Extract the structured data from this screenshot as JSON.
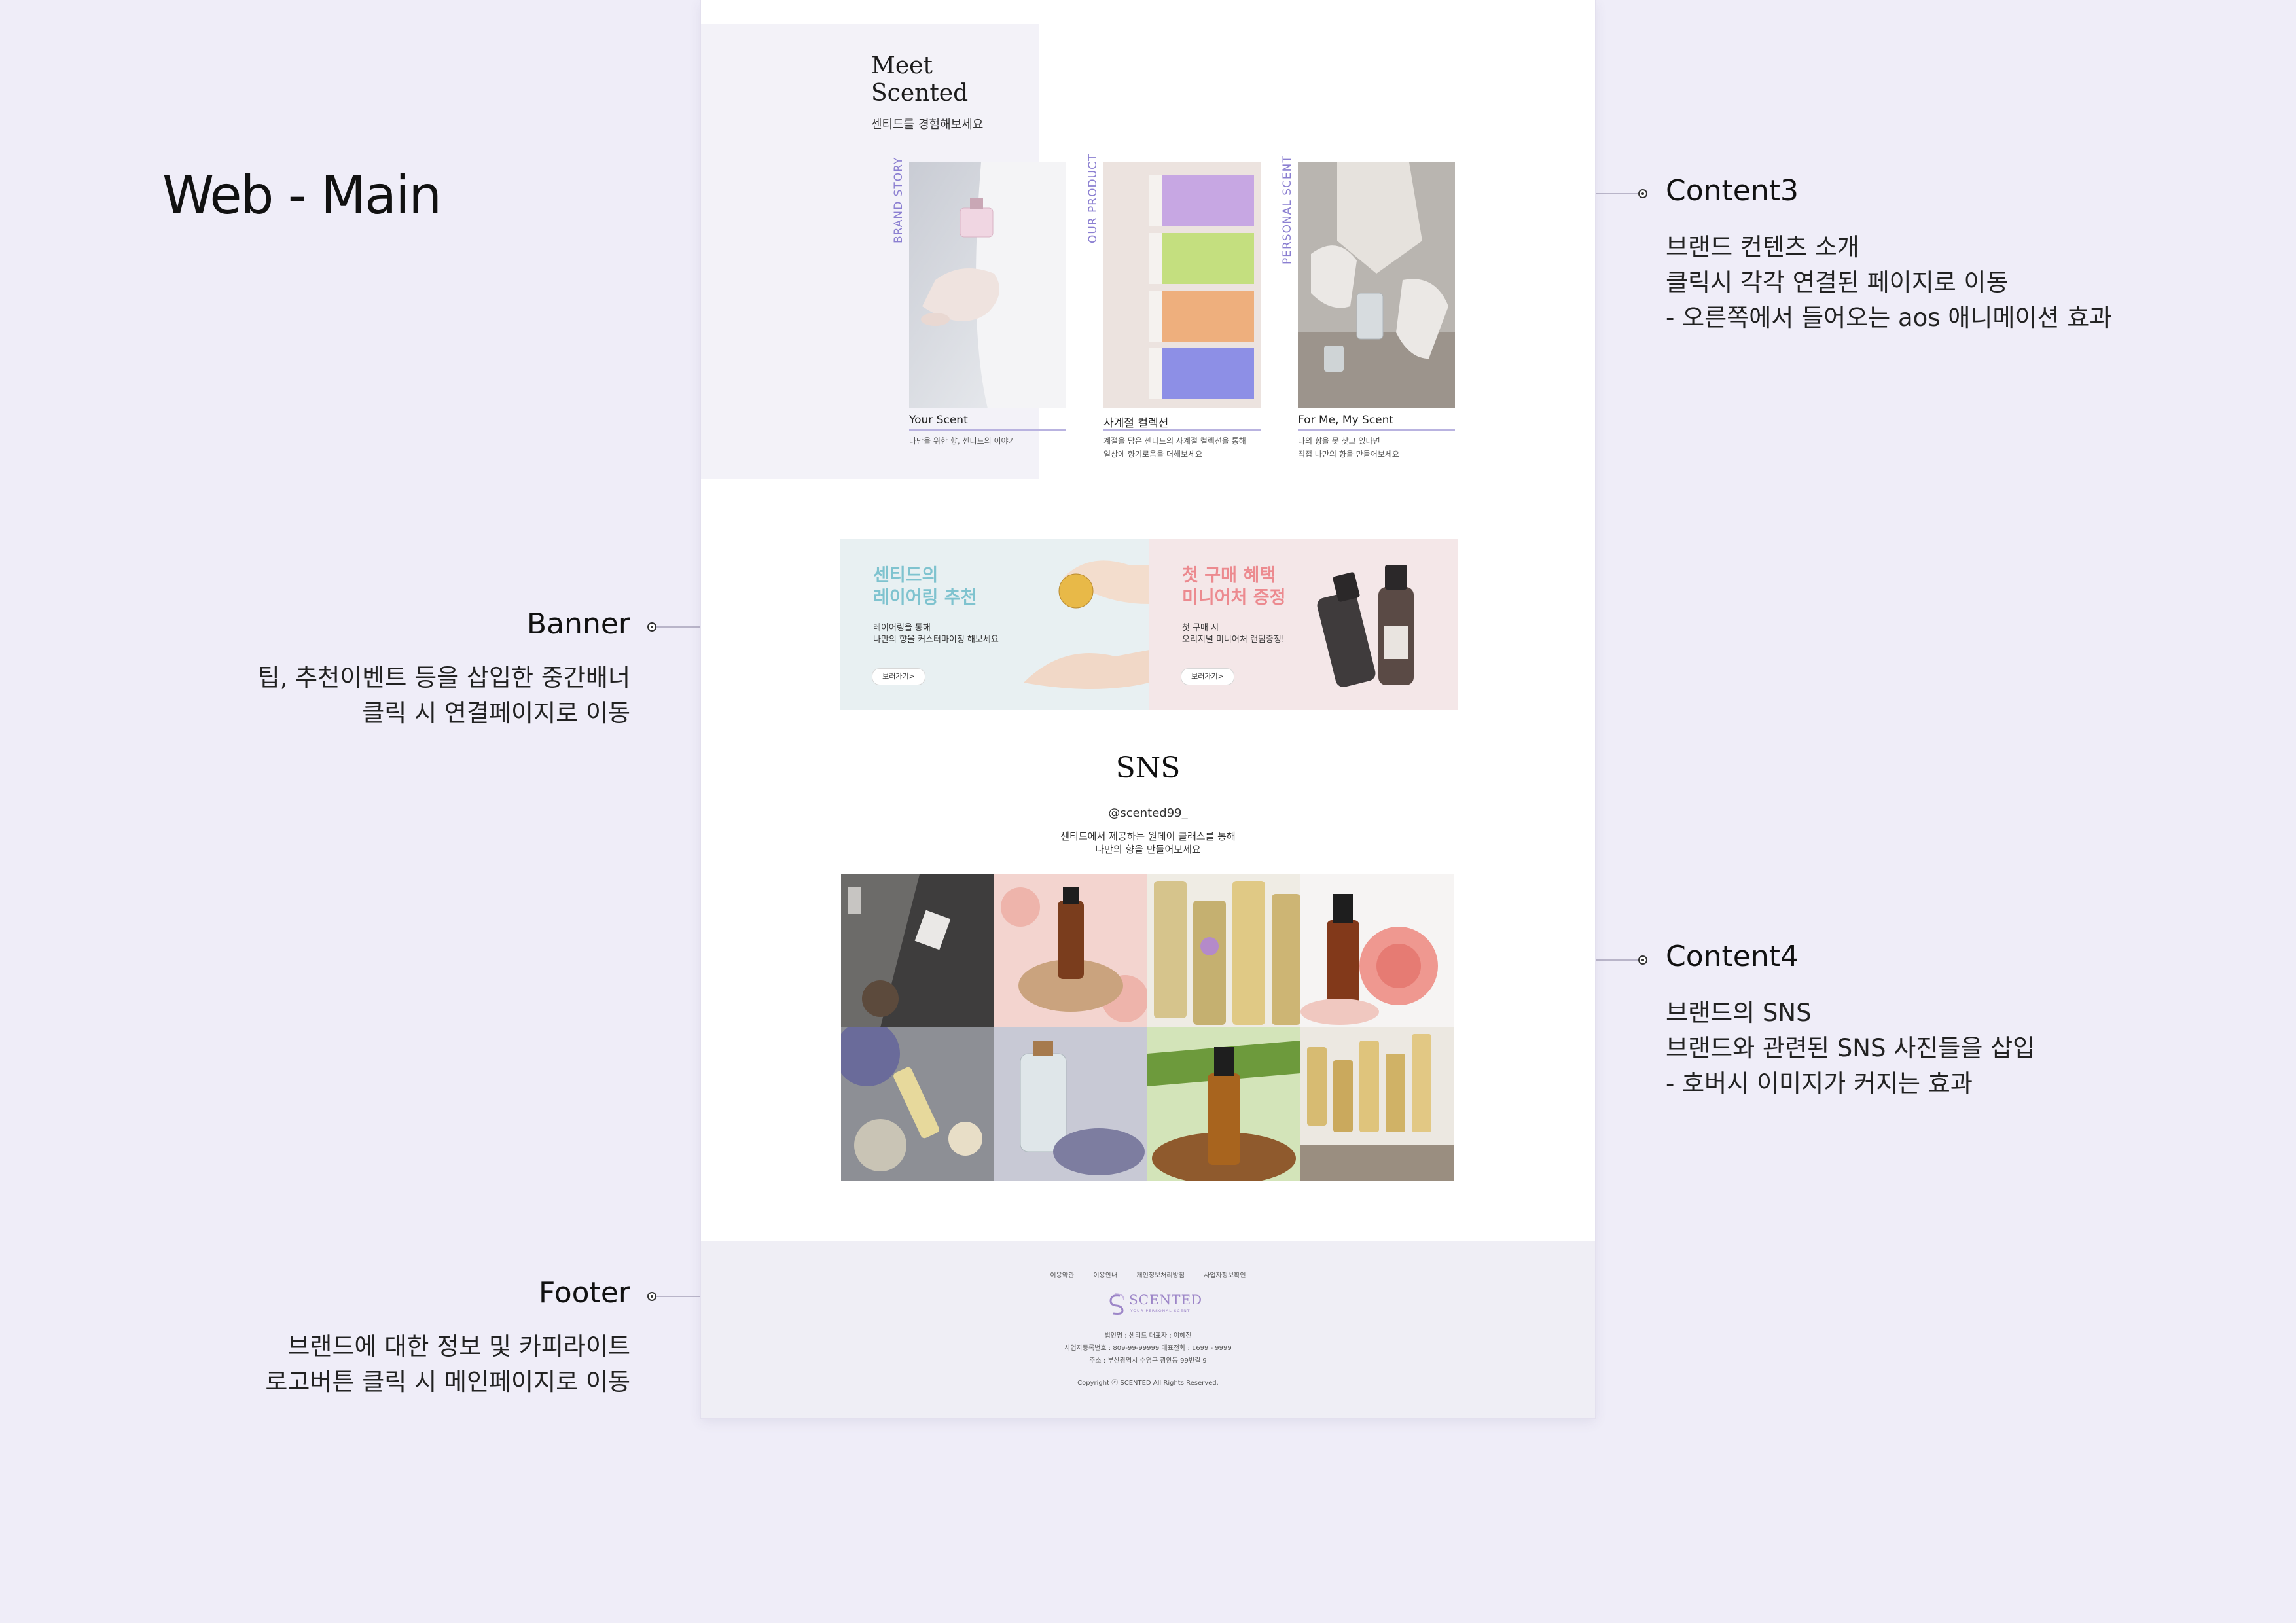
{
  "page_label": "Web - Main",
  "annotations": {
    "content3": {
      "title": "Content3",
      "lines": [
        "브랜드 컨텐츠 소개",
        "클릭시 각각 연결된 페이지로 이동",
        "- 오른쪽에서 들어오는 aos 애니메이션 효과"
      ]
    },
    "banner": {
      "title": "Banner",
      "lines": [
        "팁,  추천이벤트 등을 삽입한 중간배너",
        "클릭 시 연결페이지로 이동"
      ]
    },
    "content4": {
      "title": "Content4",
      "lines": [
        "브랜드의 SNS",
        "브랜드와 관련된 SNS 사진들을 삽입",
        "- 호버시 이미지가 커지는 효과"
      ]
    },
    "footer": {
      "title": "Footer",
      "lines": [
        "브랜드에 대한 정보 및 카피라이트",
        "로고버튼 클릭 시 메인페이지로 이동"
      ]
    }
  },
  "meet": {
    "title_line1": "Meet",
    "title_line2": "Scented",
    "subtitle": "센티드를 경험해보세요"
  },
  "cards": [
    {
      "vertical": "BRAND STORY",
      "title": "Your Scent",
      "desc1": "나만을 위한 향, 센티드의 이야기",
      "desc2": ""
    },
    {
      "vertical": "OUR PRODUCT",
      "title": "사계절 컬렉션",
      "desc1": "계절을 담은 센티드의 사계절 컬렉션을 통해",
      "desc2": "일상에 향기로움을 더해보세요"
    },
    {
      "vertical": "PERSONAL SCENT",
      "title": "For Me, My Scent",
      "desc1": "나의 향을 못 찾고 있다면",
      "desc2": "직접 나만의 향을 만들어보세요"
    }
  ],
  "banners": [
    {
      "head1": "센티드의",
      "head2": "레이어링 추천",
      "body1": "레이어링을 통해",
      "body2": "나만의 향을 커스터마이징 해보세요",
      "button": "보러가기>",
      "color": "#7fc3cf"
    },
    {
      "head1": "첫 구매 혜택",
      "head2": "미니어처 증정",
      "body1": "첫 구매 시",
      "body2": "오리지널 미니어처 랜덤증정!",
      "button": "보러가기>",
      "color": "#ec8a8f"
    }
  ],
  "sns": {
    "title": "SNS",
    "handle": "@scented99_",
    "desc1": "센티드에서 제공하는 원데이 클래스를 통해",
    "desc2": "나만의 향을 만들어보세요"
  },
  "footer": {
    "links": [
      "이용약관",
      "이용안내",
      "개인정보처리방침",
      "사업자정보확인"
    ],
    "logo_text": "SCENTED",
    "logo_tagline": "YOUR PERSONAL SCENT",
    "info1": "법인명 : 센티드     대표자 : 이혜진",
    "info2": "사업자등록번호 : 809-99-99999     대표전화 : 1699 - 9999",
    "info3": "주소 : 부산광역시 수영구 광안동 99번길 9",
    "copyright": "Copyright  ⓒ SCENTED All Rights Reserved."
  },
  "colors": {
    "accent_purple": "#8b7fd1",
    "background": "#efedf8",
    "footer_bg": "#efeef5"
  }
}
